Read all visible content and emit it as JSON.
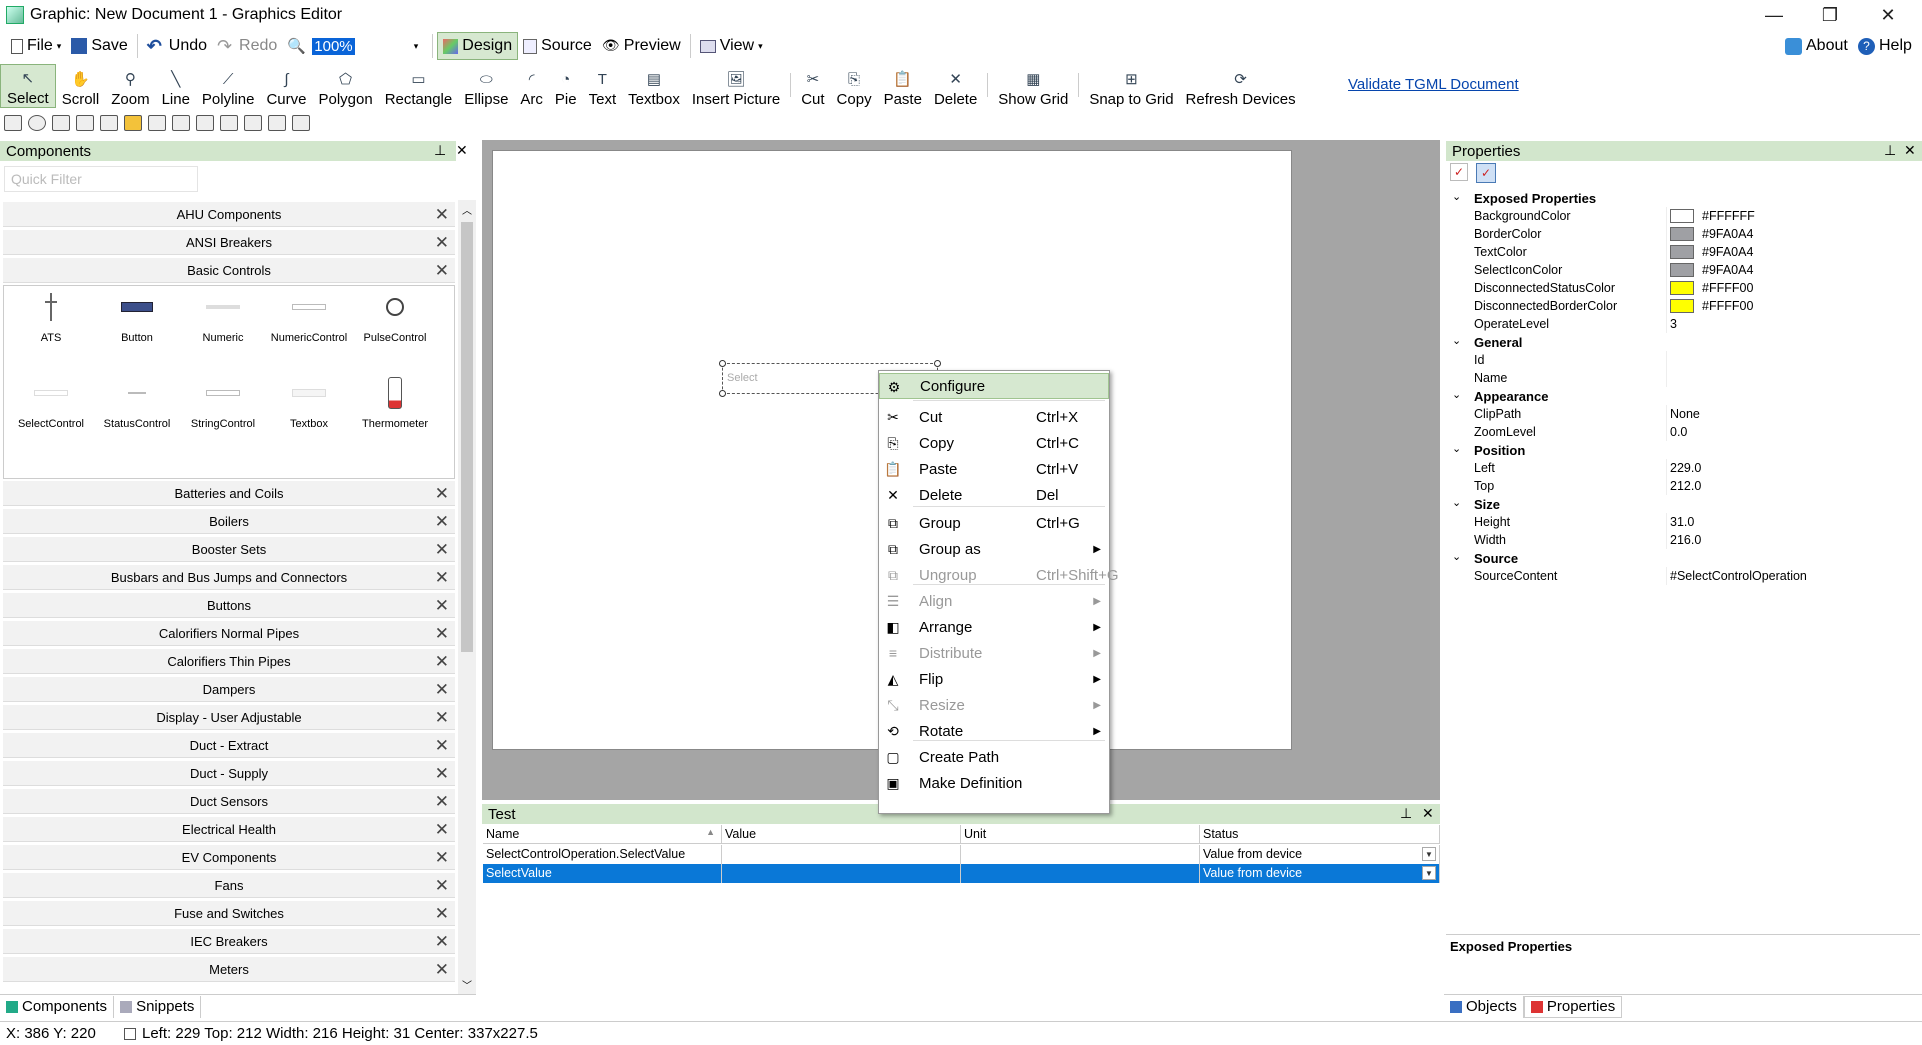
{
  "window": {
    "title": "Graphic: New Document 1 - Graphics Editor",
    "minimize": "—",
    "restore": "❐",
    "close": "✕"
  },
  "menubar": {
    "file": "File",
    "save": "Save",
    "undo": "Undo",
    "redo": "Redo",
    "zoom_value": "100%",
    "design": "Design",
    "source": "Source",
    "preview": "Preview",
    "view": "View",
    "about": "About",
    "help": "Help"
  },
  "toolbar": {
    "tools": [
      {
        "label": "Select",
        "icon": "pointer-icon"
      },
      {
        "label": "Scroll",
        "icon": "hand-icon"
      },
      {
        "label": "Zoom",
        "icon": "magnifier-icon"
      },
      {
        "label": "Line",
        "icon": "line-icon"
      },
      {
        "label": "Polyline",
        "icon": "polyline-icon"
      },
      {
        "label": "Curve",
        "icon": "curve-icon"
      },
      {
        "label": "Polygon",
        "icon": "polygon-icon"
      },
      {
        "label": "Rectangle",
        "icon": "rectangle-icon"
      },
      {
        "label": "Ellipse",
        "icon": "ellipse-icon"
      },
      {
        "label": "Arc",
        "icon": "arc-icon"
      },
      {
        "label": "Pie",
        "icon": "pie-icon"
      },
      {
        "label": "Text",
        "icon": "text-icon"
      },
      {
        "label": "Textbox",
        "icon": "textbox-icon"
      },
      {
        "label": "Insert Picture",
        "icon": "picture-icon"
      },
      {
        "label": "Cut",
        "icon": "scissors-icon"
      },
      {
        "label": "Copy",
        "icon": "copy-icon"
      },
      {
        "label": "Paste",
        "icon": "paste-icon"
      },
      {
        "label": "Delete",
        "icon": "delete-icon"
      },
      {
        "label": "Show Grid",
        "icon": "grid-icon"
      },
      {
        "label": "Snap to Grid",
        "icon": "snap-icon"
      },
      {
        "label": "Refresh Devices",
        "icon": "refresh-icon"
      }
    ],
    "validate_link": "Validate TGML Document"
  },
  "components": {
    "title": "Components",
    "pin": "📌",
    "close": "✕",
    "filter_placeholder": "Quick Filter",
    "top_categories": [
      "AHU Components",
      "ANSI Breakers",
      "Basic Controls"
    ],
    "controls": [
      {
        "label": "ATS"
      },
      {
        "label": "Button"
      },
      {
        "label": "Numeric"
      },
      {
        "label": "NumericControl"
      },
      {
        "label": "PulseControl"
      },
      {
        "label": "SelectControl"
      },
      {
        "label": "StatusControl"
      },
      {
        "label": "StringControl"
      },
      {
        "label": "Textbox"
      },
      {
        "label": "Thermometer"
      }
    ],
    "categories": [
      "Batteries and Coils",
      "Boilers",
      "Booster Sets",
      "Busbars and Bus Jumps and Connectors",
      "Buttons",
      "Calorifiers Normal Pipes",
      "Calorifiers Thin Pipes",
      "Dampers",
      "Display - User Adjustable",
      "Duct - Extract",
      "Duct - Supply",
      "Duct Sensors",
      "Electrical Health",
      "EV Components",
      "Fans",
      "Fuse and Switches",
      "IEC Breakers",
      "Meters"
    ],
    "tab_components": "Components",
    "tab_snippets": "Snippets"
  },
  "canvas": {
    "select_label": "Select"
  },
  "context_menu": {
    "items": [
      {
        "label": "Configure",
        "shortcut": "",
        "icon": "gear-icon",
        "arrow": false,
        "disabled": false,
        "highlight": true
      },
      {
        "label": "Cut",
        "shortcut": "Ctrl+X",
        "icon": "scissors-icon",
        "arrow": false,
        "disabled": false
      },
      {
        "label": "Copy",
        "shortcut": "Ctrl+C",
        "icon": "copy-icon",
        "arrow": false,
        "disabled": false
      },
      {
        "label": "Paste",
        "shortcut": "Ctrl+V",
        "icon": "paste-icon",
        "arrow": false,
        "disabled": false
      },
      {
        "label": "Delete",
        "shortcut": "Del",
        "icon": "delete-icon",
        "arrow": false,
        "disabled": false
      },
      {
        "label": "Group",
        "shortcut": "Ctrl+G",
        "icon": "group-icon",
        "arrow": false,
        "disabled": false
      },
      {
        "label": "Group as",
        "shortcut": "",
        "icon": "group-as-icon",
        "arrow": true,
        "disabled": false
      },
      {
        "label": "Ungroup",
        "shortcut": "Ctrl+Shift+G",
        "icon": "ungroup-icon",
        "arrow": false,
        "disabled": true
      },
      {
        "label": "Align",
        "shortcut": "",
        "icon": "align-icon",
        "arrow": true,
        "disabled": true
      },
      {
        "label": "Arrange",
        "shortcut": "",
        "icon": "arrange-icon",
        "arrow": true,
        "disabled": false
      },
      {
        "label": "Distribute",
        "shortcut": "",
        "icon": "distribute-icon",
        "arrow": true,
        "disabled": true
      },
      {
        "label": "Flip",
        "shortcut": "",
        "icon": "flip-icon",
        "arrow": true,
        "disabled": false
      },
      {
        "label": "Resize",
        "shortcut": "",
        "icon": "resize-icon",
        "arrow": true,
        "disabled": true
      },
      {
        "label": "Rotate",
        "shortcut": "",
        "icon": "rotate-icon",
        "arrow": true,
        "disabled": false
      },
      {
        "label": "Create Path",
        "shortcut": "",
        "icon": "path-icon",
        "arrow": false,
        "disabled": false
      },
      {
        "label": "Make Definition",
        "shortcut": "",
        "icon": "definition-icon",
        "arrow": false,
        "disabled": false
      }
    ]
  },
  "test_panel": {
    "title": "Test",
    "columns": [
      "Name",
      "Value",
      "Unit",
      "Status"
    ],
    "rows": [
      {
        "name": "SelectControlOperation.SelectValue",
        "value": "",
        "unit": "",
        "status": "Value from device"
      },
      {
        "name": "SelectValue",
        "value": "",
        "unit": "",
        "status": "Value from device"
      }
    ]
  },
  "properties": {
    "title": "Properties",
    "groups": [
      {
        "name": "Exposed Properties",
        "props": [
          {
            "name": "BackgroundColor",
            "value": "#FFFFFF",
            "swatch": "#FFFFFF"
          },
          {
            "name": "BorderColor",
            "value": "#9FA0A4",
            "swatch": "#9FA0A4"
          },
          {
            "name": "TextColor",
            "value": "#9FA0A4",
            "swatch": "#9FA0A4"
          },
          {
            "name": "SelectIconColor",
            "value": "#9FA0A4",
            "swatch": "#9FA0A4"
          },
          {
            "name": "DisconnectedStatusColor",
            "value": "#FFFF00",
            "swatch": "#FFFF00"
          },
          {
            "name": "DisconnectedBorderColor",
            "value": "#FFFF00",
            "swatch": "#FFFF00"
          },
          {
            "name": "OperateLevel",
            "value": "3",
            "swatch": ""
          }
        ]
      },
      {
        "name": "General",
        "props": [
          {
            "name": "Id",
            "value": "",
            "swatch": ""
          },
          {
            "name": "Name",
            "value": "",
            "swatch": ""
          }
        ]
      },
      {
        "name": "Appearance",
        "props": [
          {
            "name": "ClipPath",
            "value": "None",
            "swatch": ""
          },
          {
            "name": "ZoomLevel",
            "value": "0.0",
            "swatch": ""
          }
        ]
      },
      {
        "name": "Position",
        "props": [
          {
            "name": "Left",
            "value": "229.0",
            "swatch": ""
          },
          {
            "name": "Top",
            "value": "212.0",
            "swatch": ""
          }
        ]
      },
      {
        "name": "Size",
        "props": [
          {
            "name": "Height",
            "value": "31.0",
            "swatch": ""
          },
          {
            "name": "Width",
            "value": "216.0",
            "swatch": ""
          }
        ]
      },
      {
        "name": "Source",
        "props": [
          {
            "name": "SourceContent",
            "value": "#SelectControlOperation",
            "swatch": ""
          }
        ]
      }
    ],
    "description_title": "Exposed Properties",
    "tab_objects": "Objects",
    "tab_properties": "Properties"
  },
  "statusbar": {
    "xy": "X: 386  Y: 220",
    "geom": "Left: 229  Top: 212  Width: 216  Height: 31  Center: 337x227.5"
  }
}
